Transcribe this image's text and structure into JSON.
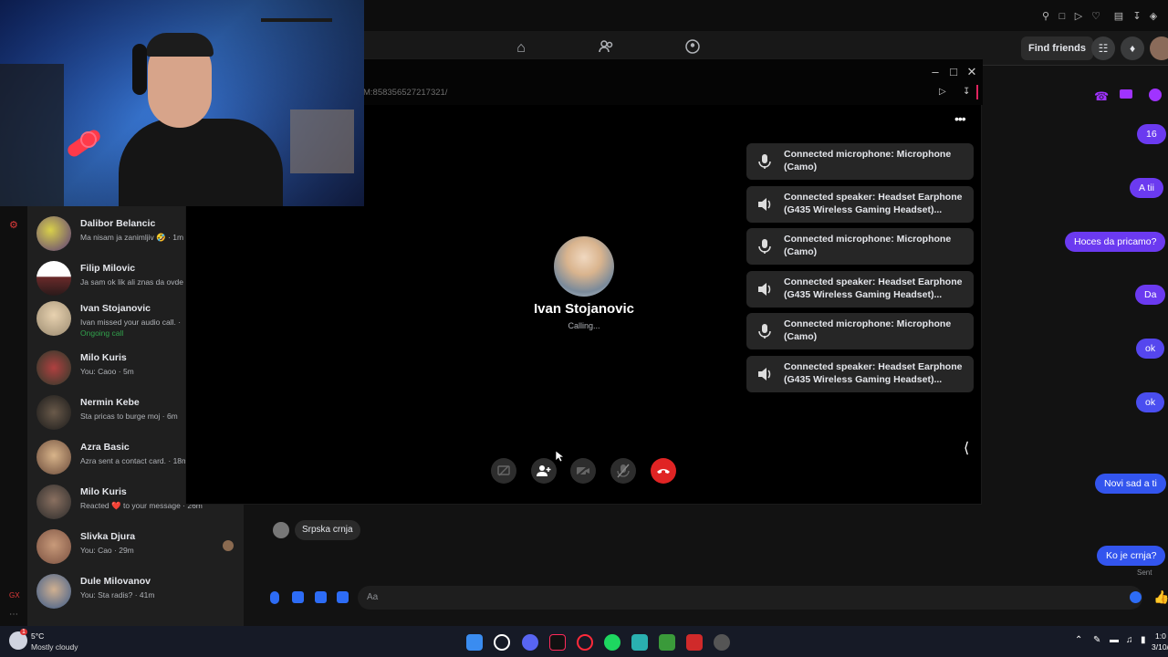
{
  "browser": {
    "url_fragment": "M:858356527217321/"
  },
  "header": {
    "find_friends_label": "Find friends"
  },
  "chats": [
    {
      "name": "Dalibor Belancic",
      "preview": "Ma nisam ja zanimljiv 🤣 · 1m",
      "status": ""
    },
    {
      "name": "Filip Milovic",
      "preview": "Ja sam ok lik ali znas da ovde",
      "status": ""
    },
    {
      "name": "Ivan Stojanovic",
      "preview": "Ivan missed your audio call. ·",
      "status": "Ongoing call"
    },
    {
      "name": "Milo Kuris",
      "preview": "You: Caoo · 5m",
      "status": ""
    },
    {
      "name": "Nermin Kebe",
      "preview": "Sta pricas to burge moj · 6m",
      "status": ""
    },
    {
      "name": "Azra Basic",
      "preview": "Azra sent a contact card. · 18m",
      "status": ""
    },
    {
      "name": "Milo Kuris",
      "preview": "Reacted ❤️ to your message · 26m",
      "status": ""
    },
    {
      "name": "Slivka Djura",
      "preview": "You: Cao · 29m",
      "status": ""
    },
    {
      "name": "Dule Milovanov",
      "preview": "You: Sta radis? · 41m",
      "status": ""
    }
  ],
  "messages": {
    "sent": [
      "16",
      "A tii",
      "Hoces da pricamo?",
      "Da",
      "ok",
      "ok",
      "Novi sad a ti",
      "Ko je crnja?"
    ],
    "received": "Srpska crnja",
    "sent_status": "Sent"
  },
  "composer": {
    "placeholder": "Aa"
  },
  "call": {
    "contact_name": "Ivan Stojanovic",
    "status": "Calling...",
    "devices": [
      {
        "type": "mic-icon",
        "text": "Connected microphone: Microphone (Camo)"
      },
      {
        "type": "speaker-icon",
        "text": "Connected speaker: Headset Earphone (G435 Wireless Gaming Headset)..."
      },
      {
        "type": "mic-icon",
        "text": "Connected microphone: Microphone (Camo)"
      },
      {
        "type": "speaker-icon",
        "text": "Connected speaker: Headset Earphone (G435 Wireless Gaming Headset)..."
      },
      {
        "type": "mic-icon",
        "text": "Connected microphone: Microphone (Camo)"
      },
      {
        "type": "speaker-icon",
        "text": "Connected speaker: Headset Earphone (G435 Wireless Gaming Headset)..."
      }
    ]
  },
  "taskbar": {
    "temperature": "5°C",
    "weather": "Mostly cloudy",
    "notification_badge": "1",
    "time_partial": "1:0",
    "date_partial": "3/10/"
  },
  "colors": {
    "accent_purple": "#6b3af0",
    "accent_blue": "#3355ee",
    "end_call_red": "#e02424",
    "online_green": "#31a24c"
  }
}
